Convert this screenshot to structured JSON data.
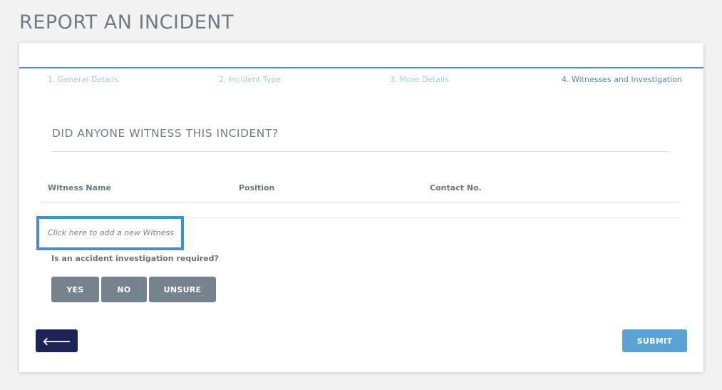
{
  "page": {
    "title": "REPORT AN INCIDENT"
  },
  "steps": [
    {
      "label": "1. General Details",
      "active": false
    },
    {
      "label": "2. Incident Type",
      "active": false
    },
    {
      "label": "3. More Details",
      "active": false
    },
    {
      "label": "4. Witnesses and Investigation",
      "active": true
    }
  ],
  "witness_section": {
    "title": "DID ANYONE WITNESS THIS INCIDENT?",
    "columns": [
      "Witness Name",
      "Position",
      "Contact No."
    ],
    "rows": [],
    "add_link": "Click here to add a new Witness"
  },
  "investigation": {
    "question": "Is an accident investigation required?",
    "options": [
      "YES",
      "NO",
      "UNSURE"
    ]
  },
  "footer": {
    "back_icon": "arrow-left-icon",
    "back_glyph": "🡐",
    "submit_label": "SUBMIT"
  },
  "colors": {
    "accent": "#4a8ec8",
    "highlight_border": "#3e94c8",
    "back_button": "#1c2456",
    "submit_button": "#5aa3d5",
    "option_button": "#75838c"
  }
}
